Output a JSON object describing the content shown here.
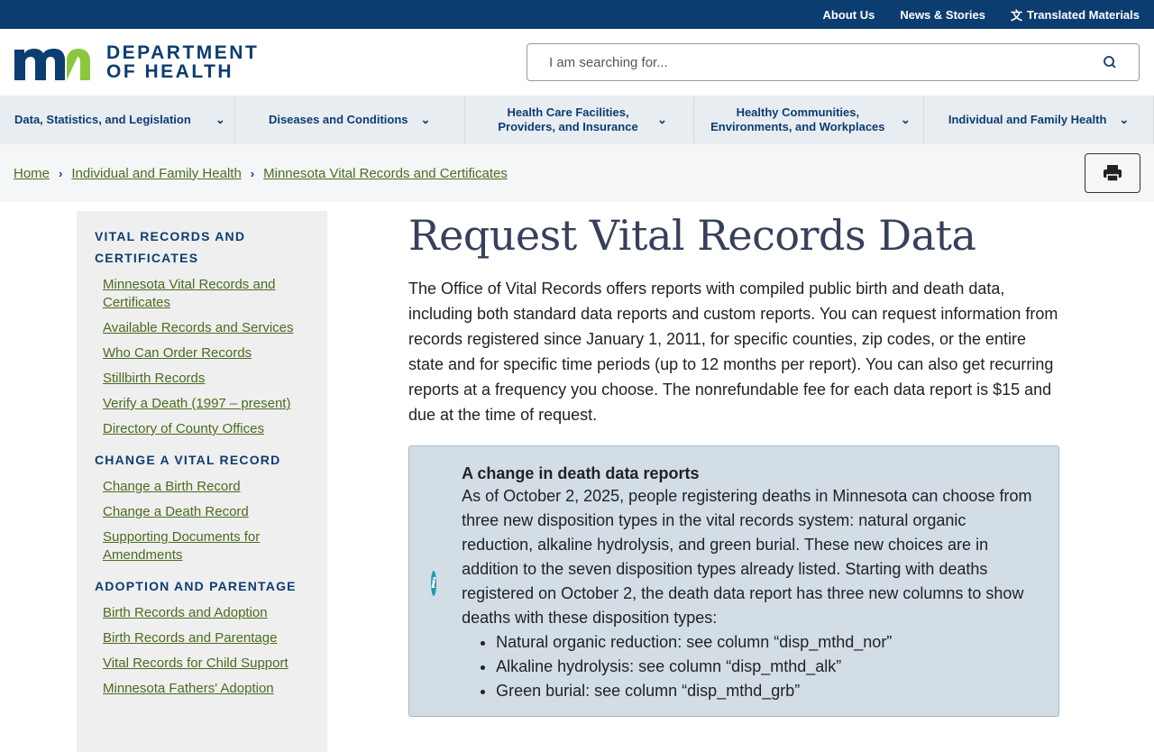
{
  "topbar": {
    "links": [
      "About Us",
      "News & Stories",
      "Translated Materials"
    ]
  },
  "logo": {
    "line1": "DEPARTMENT",
    "line2": "OF HEALTH"
  },
  "search": {
    "placeholder": "I am searching for..."
  },
  "nav": [
    "Data, Statistics, and Legislation",
    "Diseases and Conditions",
    "Health Care Facilities, Providers, and Insurance",
    "Healthy Communities, Environments, and Workplaces",
    "Individual and Family Health"
  ],
  "breadcrumb": [
    "Home",
    "Individual and Family Health",
    "Minnesota Vital Records and Certificates"
  ],
  "sidebar": [
    {
      "title": "VITAL RECORDS AND CERTIFICATES",
      "links": [
        "Minnesota Vital Records and Certificates",
        "Available Records and Services",
        "Who Can Order Records",
        "Stillbirth Records",
        "Verify a Death (1997 – present)",
        "Directory of County Offices"
      ]
    },
    {
      "title": "CHANGE A VITAL RECORD",
      "links": [
        "Change a Birth Record",
        "Change a Death Record",
        "Supporting Documents for Amendments"
      ]
    },
    {
      "title": "ADOPTION AND PARENTAGE",
      "links": [
        "Birth Records and Adoption",
        "Birth Records and Parentage",
        "Vital Records for Child Support",
        "Minnesota Fathers' Adoption"
      ]
    }
  ],
  "main": {
    "title": "Request Vital Records Data",
    "intro": "The Office of Vital Records offers reports with compiled public birth and death data, including both standard data reports and custom reports. You can request information from records registered since January 1, 2011, for specific counties, zip codes, or the entire state and for specific time periods (up to 12 months per report). You can also get recurring reports at a frequency you choose. The nonrefundable fee for each data report is $15 and due at the time of request.",
    "callout": {
      "title": "A change in death data reports",
      "body": "As of October 2, 2025, people registering deaths in Minnesota can choose from three new disposition types in the vital records system: natural organic reduction, alkaline hydrolysis, and green burial. These new choices are in addition to the seven disposition types already listed. Starting with deaths registered on October 2, the death data report has three new columns to show deaths with these disposition types:",
      "items": [
        "Natural organic reduction: see column “disp_mthd_nor”",
        "Alkaline hydrolysis: see column “disp_mthd_alk”",
        "Green burial: see column “disp_mthd_grb”"
      ]
    }
  }
}
